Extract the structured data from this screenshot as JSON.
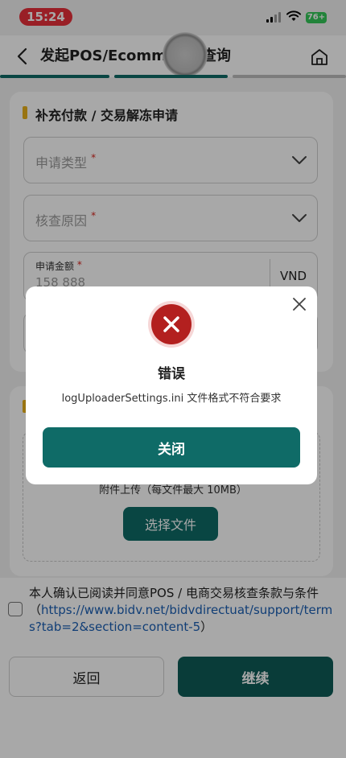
{
  "status_bar": {
    "time": "15:24",
    "battery": "76+"
  },
  "header": {
    "title": "发起POS/Ecommerce查询"
  },
  "section1": {
    "title": "补充付款 / 交易解冻申请",
    "apply_type_label": "申请类型",
    "check_reason_label": "核查原因",
    "amount_label": "申请金额",
    "amount_value": "158 888",
    "currency": "VND",
    "required_mark": "*"
  },
  "upload": {
    "hint": "附件上传（每文件最大 10MB）",
    "choose_file_label": "选择文件"
  },
  "terms": {
    "text": "本人确认已阅读并同意POS / 电商交易核查条款与条件（",
    "link": "https://www.bidv.net/bidvdirectuat/support/terms?tab=2&section=content-5",
    "close_paren": "）"
  },
  "footer": {
    "back_label": "返回",
    "continue_label": "继续"
  },
  "dialog": {
    "title": "错误",
    "message": "logUploaderSettings.ini 文件格式不符合要求",
    "close_label": "关闭"
  },
  "colors": {
    "primary": "#0f6b67",
    "error": "#b3201f",
    "accent": "#e9b11b",
    "link": "#1a5fb4"
  }
}
